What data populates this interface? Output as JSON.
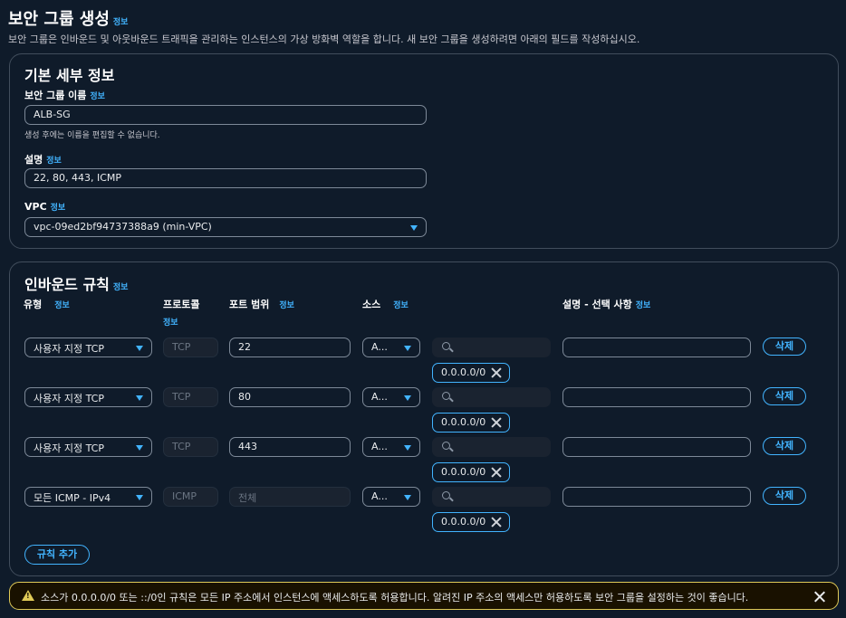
{
  "page": {
    "title": "보안 그룹 생성",
    "info": "정보",
    "subtitle": "보안 그룹은 인바운드 및 아웃바운드 트래픽을 관리하는 인스턴스의 가상 방화벽 역할을 합니다. 새 보안 그룹을 생성하려면 아래의 필드를 작성하십시오."
  },
  "basic": {
    "title": "기본 세부 정보",
    "name_label": "보안 그룹 이름",
    "name_value": "ALB-SG",
    "name_hint": "생성 후에는 이름을 편집할 수 없습니다.",
    "desc_label": "설명",
    "desc_value": "22, 80, 443, ICMP",
    "vpc_label": "VPC",
    "vpc_value": "vpc-09ed2bf94737388a9 (min-VPC)"
  },
  "inbound": {
    "title": "인바운드 규칙",
    "headers": {
      "type": "유형",
      "protocol": "프로토콜",
      "port": "포트 범위",
      "source": "소스",
      "description": "설명 - 선택 사항"
    },
    "rules": [
      {
        "type": "사용자 지정 TCP",
        "protocol": "TCP",
        "port": "22",
        "source": "A...",
        "cidr": "0.0.0.0/0",
        "delete": "삭제"
      },
      {
        "type": "사용자 지정 TCP",
        "protocol": "TCP",
        "port": "80",
        "source": "A...",
        "cidr": "0.0.0.0/0",
        "delete": "삭제"
      },
      {
        "type": "사용자 지정 TCP",
        "protocol": "TCP",
        "port": "443",
        "source": "A...",
        "cidr": "0.0.0.0/0",
        "delete": "삭제"
      },
      {
        "type": "모든 ICMP - IPv4",
        "protocol": "ICMP",
        "port": "전체",
        "source": "A...",
        "cidr": "0.0.0.0/0",
        "delete": "삭제"
      }
    ],
    "add_rule": "규칙 추가"
  },
  "alert": {
    "icon": "warning-icon",
    "text": "소스가 0.0.0.0/0 또는 ::/0인 규칙은 모든 IP 주소에서 인스턴스에 액세스하도록 허용합니다. 알려진 IP 주소의 액세스만 허용하도록 보안 그룹을 설정하는 것이 좋습니다."
  },
  "colors": {
    "background": "#0f1b2a",
    "accent": "#42b4ff",
    "warning": "#e0ca57"
  }
}
